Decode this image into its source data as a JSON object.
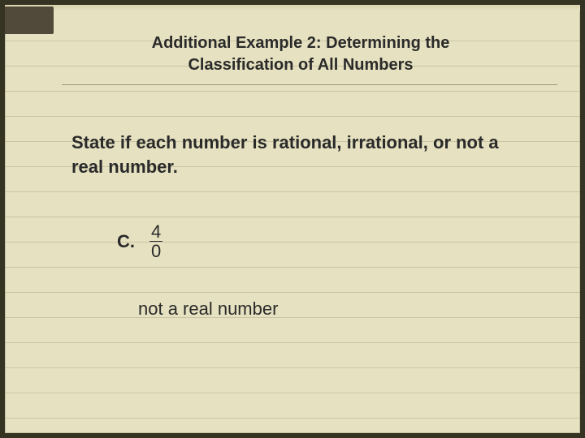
{
  "title": {
    "line1": "Additional Example 2: Determining the",
    "line2": "Classification of All Numbers"
  },
  "prompt": "State if each number is rational, irrational, or not a real number.",
  "item": {
    "label": "C.",
    "fraction": {
      "numerator": "4",
      "denominator": "0"
    }
  },
  "answer": "not a real number"
}
